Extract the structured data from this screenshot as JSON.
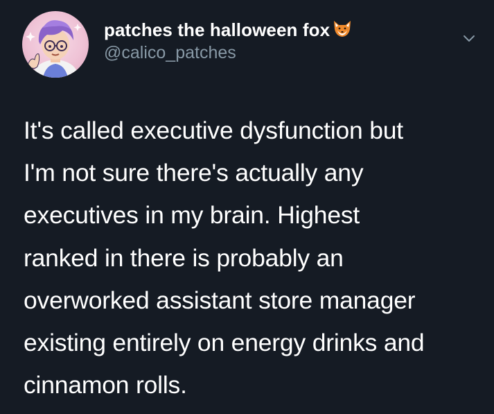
{
  "tweet": {
    "display_name": "patches the halloween fox",
    "handle": "@calico_patches",
    "text_lines": [
      "It's called executive dysfunction but",
      "I'm not sure there's actually any",
      "executives in my brain. Highest",
      "ranked in there is probably an",
      "overworked assistant store manager",
      "existing entirely on energy drinks and",
      "cinnamon rolls."
    ]
  },
  "icons": {
    "avatar": "avatar",
    "name_emoji": "fox-face-icon",
    "menu": "chevron-down-icon"
  },
  "colors": {
    "background": "#151b24",
    "text": "#ffffff",
    "secondary_text": "#8899a6"
  }
}
